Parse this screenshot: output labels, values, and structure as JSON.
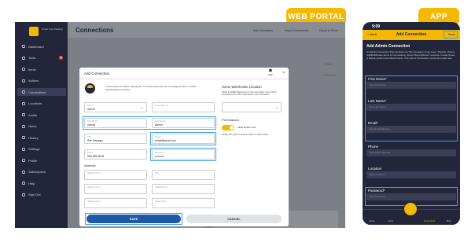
{
  "tags": {
    "web": "WEB PORTAL",
    "app": "APP"
  },
  "colors": {
    "brand": "#f5b800",
    "navy": "#23263a",
    "highlight": "#3aa0e8",
    "save": "#1e5aa8"
  },
  "logo": {
    "text": "Smart Tool Tracking"
  },
  "sidebar": {
    "items": [
      {
        "label": "Dashboard",
        "icon": "dashboard-icon"
      },
      {
        "label": "Tools",
        "icon": "tools-icon",
        "badge": "16"
      },
      {
        "label": "Items",
        "icon": "items-icon"
      },
      {
        "label": "Actions",
        "icon": "actions-icon"
      },
      {
        "label": "Connections",
        "icon": "connections-icon"
      },
      {
        "label": "Locations",
        "icon": "locations-icon"
      },
      {
        "label": "Audits",
        "icon": "audits-icon"
      },
      {
        "label": "Notes",
        "icon": "notes-icon"
      },
      {
        "label": "History",
        "icon": "history-icon"
      },
      {
        "label": "Settings",
        "icon": "settings-icon"
      },
      {
        "label": "Profile",
        "icon": "profile-icon"
      },
      {
        "label": "Subscription",
        "icon": "subscription-icon"
      },
      {
        "label": "Help",
        "icon": "help-icon"
      },
      {
        "label": "Sign Out",
        "icon": "signout-icon"
      }
    ]
  },
  "main": {
    "title": "Connections",
    "actions": [
      "Add Connection",
      "Import Connections",
      "Export to Excel"
    ],
    "results": "10 Results",
    "filters": "Filters"
  },
  "bg_cards": [
    "Virtual Glitch's Engine Repair",
    "Virtual Job Staging"
  ],
  "modal": {
    "title": "Add Connection",
    "help": "Help",
    "close": "×",
    "description": "Connections are Admin, Employee, or Virtual users that can be assigned items or have administrative functions.",
    "role": {
      "label": "Role *",
      "value": "Admin"
    },
    "connection_id": {
      "label": "Connection ID",
      "value": ""
    },
    "first_name": {
      "label": "First Name *",
      "value": "Admily"
    },
    "last_name": {
      "label": "Last Name *",
      "value": "Admin"
    },
    "title_field": {
      "label": "Title",
      "value": "Site Manager"
    },
    "email": {
      "label": "Email *",
      "value": "email@email.com"
    },
    "phone": {
      "label": "Phone",
      "value": "555-555-5678"
    },
    "password": {
      "label": "Password *",
      "value": "••••••••••"
    },
    "address_section": "Address",
    "address1": {
      "label": "Address Line 1"
    },
    "city": {
      "label": "City"
    },
    "address2": {
      "label": "Address Line 2"
    },
    "state": {
      "label": "State/Province"
    },
    "address3": {
      "label": "Address Line 3"
    },
    "postal": {
      "label": "Postal Code"
    },
    "home_location": "Home Warehouse Location",
    "home_desc": "Select a HOME Warehouse for this Connection. Items will be transferred here when returned from this Connection.",
    "permissions": "Permissions",
    "allow_delete": "Allow Delete Tool",
    "allow_desc": "Enable this option to allow an admin to delete items.",
    "save": "SAVE",
    "cancel": "CANCEL"
  },
  "phone": {
    "time": "9:09",
    "back": "< Back",
    "title": "Add Connection",
    "save": "Save",
    "subtitle": "Add Admin Connection",
    "desc": "An Admin Connection Role functions as The Company. It can Loan, Transfer, Return, Add/Edit/Delete Items & Connections, Accept Borrow/Return requests, Create Notes, & Delete system level Attachments. This type of Connection counts as a paid user.",
    "fields": [
      {
        "label": "First Name*",
        "placeholder": "Type First Name"
      },
      {
        "label": "Last Name*",
        "placeholder": "Type Last Name"
      },
      {
        "label": "Email*",
        "placeholder": "Type Email Address"
      },
      {
        "label": "Phone",
        "placeholder": "Type Phone Number"
      },
      {
        "label": "Location",
        "placeholder": "Select Location"
      },
      {
        "label": "Password*",
        "placeholder": "Type Password"
      }
    ],
    "nav": [
      "Home",
      "Items",
      "Connections",
      "More"
    ]
  }
}
